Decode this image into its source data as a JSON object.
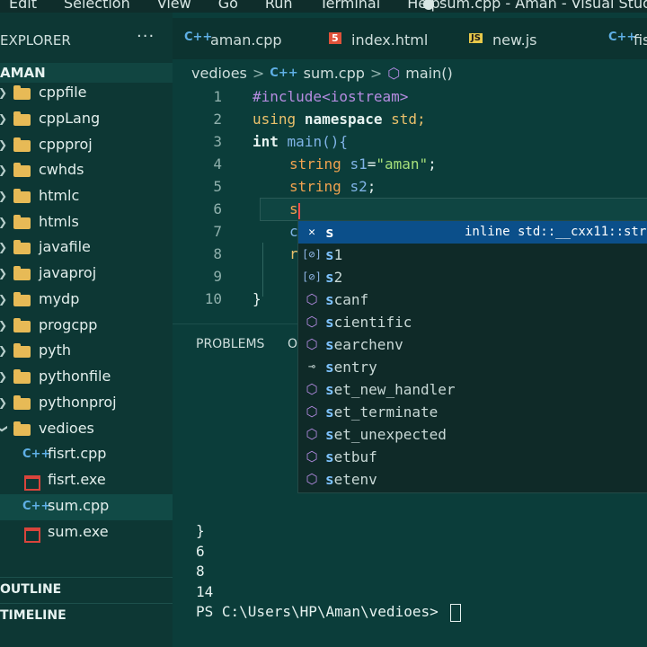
{
  "menu": [
    "Edit",
    "Selection",
    "View",
    "Go",
    "Run",
    "Terminal",
    "Help"
  ],
  "window_title": "● sum.cpp - Aman - Visual Studio Co",
  "sidebar": {
    "header": "EXPLORER",
    "more": "···",
    "root": "AMAN",
    "folders": [
      "cppfile",
      "cppLang",
      "cppproj",
      "cwhds",
      "htmlc",
      "htmls",
      "javafile",
      "javaproj",
      "mydp",
      "progcpp",
      "pyth",
      "pythonfile",
      "pythonproj",
      "vedioes"
    ],
    "files": [
      {
        "name": "fisrt.cpp",
        "icon": "cpp-icon"
      },
      {
        "name": "fisrt.exe",
        "icon": "exe-icon"
      },
      {
        "name": "sum.cpp",
        "icon": "cpp-icon"
      },
      {
        "name": "sum.exe",
        "icon": "exe-icon"
      }
    ],
    "outline": "OUTLINE",
    "timeline": "TIMELINE"
  },
  "tabs": [
    {
      "label": "aman.cpp",
      "icon": "C++"
    },
    {
      "label": "index.html",
      "icon": "5"
    },
    {
      "label": "new.js",
      "icon": "JS"
    },
    {
      "label": "fis",
      "icon": "C++"
    }
  ],
  "breadcrumb": [
    "vedioes",
    "sum.cpp",
    "main()"
  ],
  "editor": {
    "line_numbers": [
      "1",
      "2",
      "3",
      "4",
      "5",
      "6",
      "7",
      "8",
      "9",
      "10"
    ],
    "l1_inc": "#include<iostream>",
    "l2_using": "using",
    "l2_ns": "namespace",
    "l2_std": "std;",
    "l3_int": "int",
    "l3_main": "main(){",
    "l4_type": "string",
    "l4_var": "s1",
    "l4_eq": "=",
    "l4_str": "\"aman\"",
    "l4_end": ";",
    "l5_type": "string",
    "l5_var": "s2",
    "l5_end": ";",
    "l6": "s",
    "l7": "c",
    "l8": "r",
    "l10": "}"
  },
  "panel": {
    "problems": "PROBLEMS",
    "output": "O"
  },
  "terminal": [
    "}",
    "6",
    "8",
    "14",
    "PS C:\\Users\\HP\\Aman\\vedioes> "
  ],
  "suggestions": {
    "detail": "inline std::__cxx11::str",
    "items": [
      {
        "match": "s",
        "rest": "",
        "icon": "abbr"
      },
      {
        "match": "s",
        "rest": "1",
        "icon": "variable"
      },
      {
        "match": "s",
        "rest": "2",
        "icon": "variable"
      },
      {
        "match": "s",
        "rest": "canf",
        "icon": "method"
      },
      {
        "match": "s",
        "rest": "cientific",
        "icon": "method"
      },
      {
        "match": "s",
        "rest": "earchenv",
        "icon": "method"
      },
      {
        "match": "s",
        "rest": "entry",
        "icon": "field"
      },
      {
        "match": "s",
        "rest": "et_new_handler",
        "icon": "method"
      },
      {
        "match": "s",
        "rest": "et_terminate",
        "icon": "method"
      },
      {
        "match": "s",
        "rest": "et_unexpected",
        "icon": "method"
      },
      {
        "match": "s",
        "rest": "etbuf",
        "icon": "method"
      },
      {
        "match": "s",
        "rest": "etenv",
        "icon": "method"
      }
    ]
  },
  "colors": {
    "background": "#0b3d3a",
    "selection": "#0b4f8a",
    "folder": "#e7ba56",
    "keyword": "#7fb3e6",
    "string": "#a6df7a",
    "type": "#f0a24f"
  }
}
